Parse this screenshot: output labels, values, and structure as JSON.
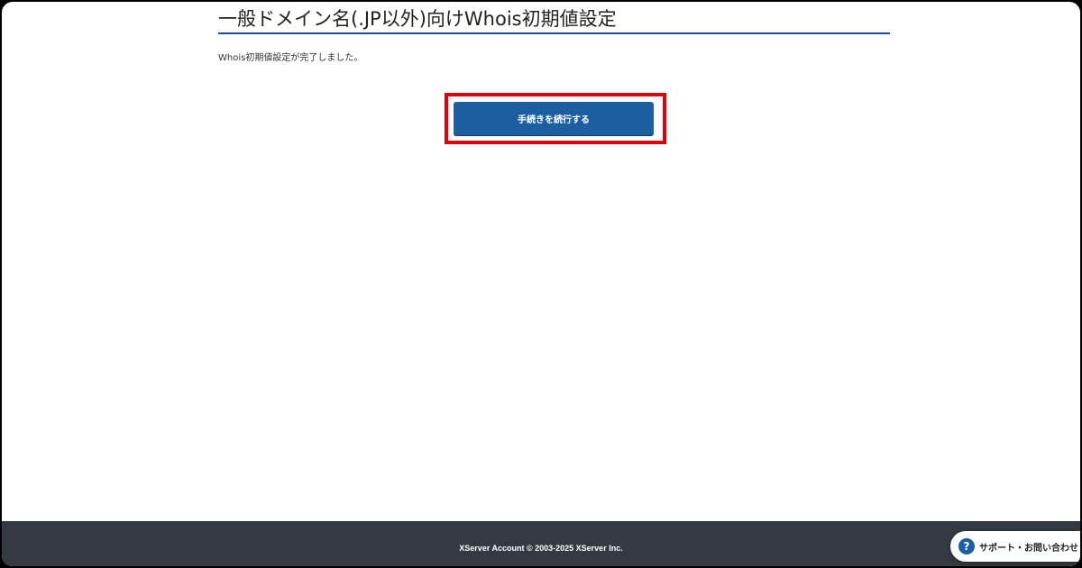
{
  "page": {
    "title": "一般ドメイン名(.JP以外)向けWhois初期値設定",
    "message": "Whois初期値設定が完了しました。"
  },
  "actions": {
    "continue_label": "手続きを続行する"
  },
  "footer": {
    "copyright": "XServer Account © 2003-2025 XServer Inc."
  },
  "support": {
    "icon": "question-circle-icon",
    "icon_glyph": "?",
    "label": "サポート・お問い合わせ"
  },
  "colors": {
    "accent": "#1c5fa0",
    "title_rule": "#1a4f93",
    "highlight": "#e0000b",
    "footer_bg": "#343a41"
  }
}
